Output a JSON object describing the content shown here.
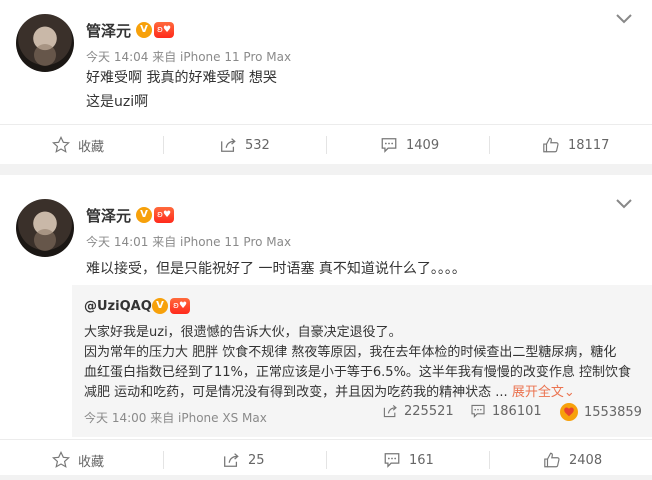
{
  "posts": [
    {
      "author": "管泽元",
      "verified_mark": "V",
      "level_mark": "ʚ♥",
      "meta": "今天 14:04 来自 iPhone 11 Pro Max",
      "lines": [
        "好难受啊 我真的好难受啊 想哭",
        "这是uzi啊"
      ],
      "actions": {
        "favorite": "收藏",
        "repost": "532",
        "comment": "1409",
        "like": "18117"
      }
    },
    {
      "author": "管泽元",
      "verified_mark": "V",
      "level_mark": "ʚ♥",
      "meta": "今天 14:01 来自 iPhone 11 Pro Max",
      "lines": [
        "难以接受，但是只能祝好了 一时语塞 真不知道说什么了。。。。"
      ],
      "quote": {
        "author": "@UziQAQ",
        "lines": [
          "大家好我是uzi，很遗憾的告诉大伙，自豪决定退役了。",
          "因为常年的压力大 肥胖 饮食不规律 熬夜等原因，我在去年体检的时候查出二型糖尿病，糖化",
          "血红蛋白指数已经到了11%，正常应该是小于等于6.5%。这半年我有慢慢的改变作息 控制饮食",
          "减肥 运动和吃药，可是情况没有得到改变，并且因为吃药我的精神状态 ..."
        ],
        "expand_label": "展开全文",
        "expand_arrow": "⌄",
        "meta": "今天 14:00 来自 iPhone XS Max",
        "reposts": "225521",
        "comments": "186101",
        "likes": "1553859"
      },
      "actions": {
        "favorite": "收藏",
        "repost": "25",
        "comment": "161",
        "like": "2408"
      }
    }
  ],
  "icons": {
    "favorite": "star-icon",
    "repost": "share-icon",
    "comment": "comment-icon",
    "like": "thumbs-up-icon",
    "menu": "chevron-down-icon"
  },
  "colors": {
    "accent": "#eb7350",
    "verified": "#f7a10b",
    "text": "#333333",
    "meta": "#8a8a8a"
  }
}
